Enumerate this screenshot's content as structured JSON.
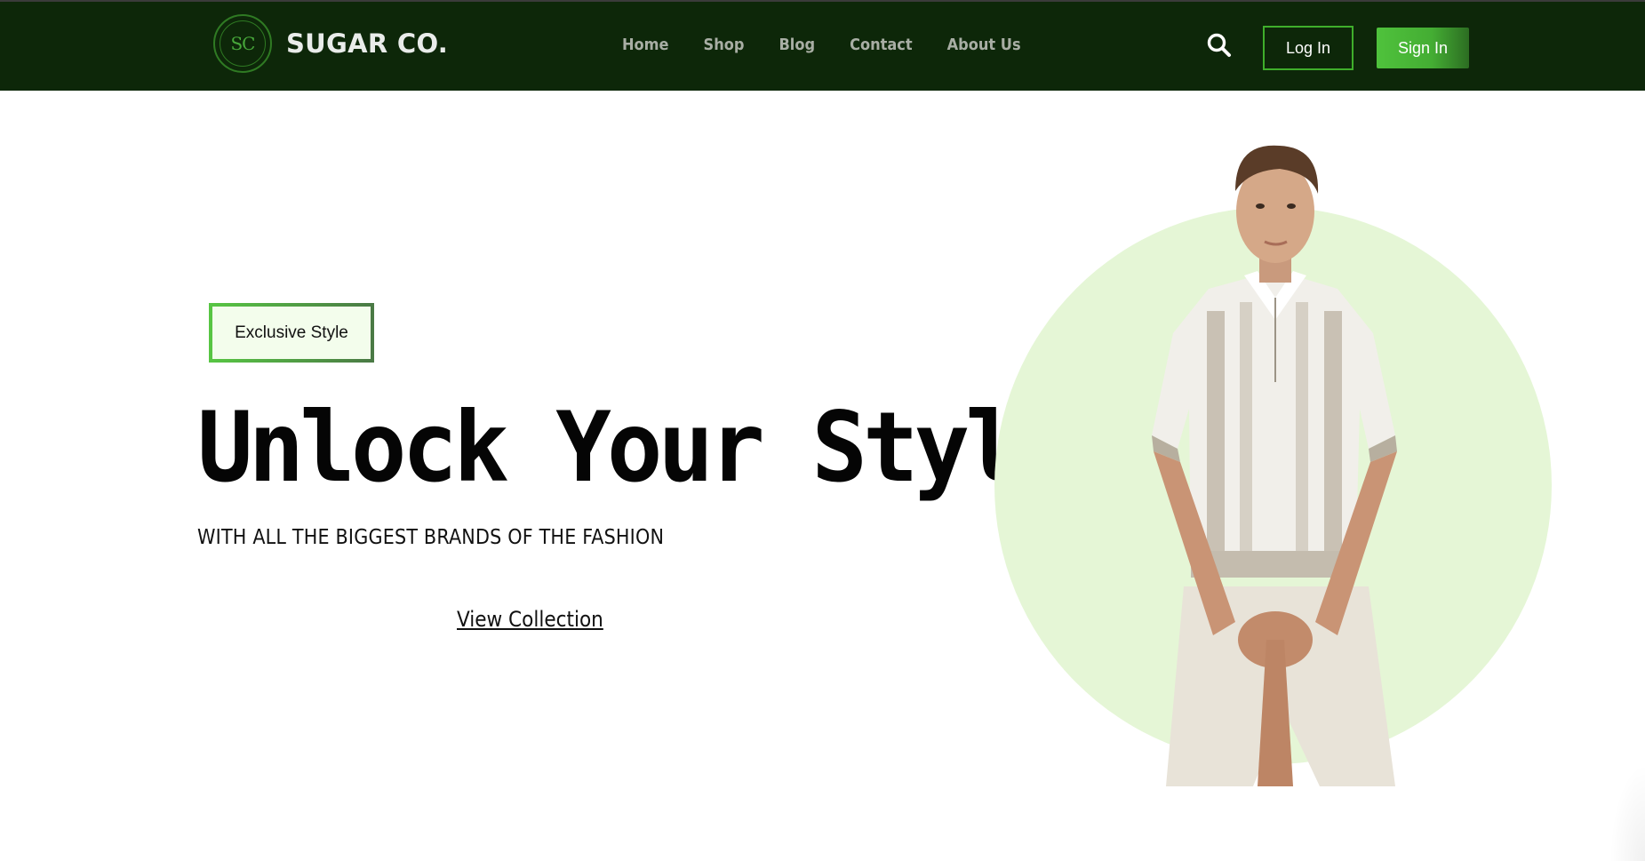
{
  "brand": {
    "logo_monogram": "SC",
    "name": "SUGAR CO."
  },
  "nav": {
    "links": [
      "Home",
      "Shop",
      "Blog",
      "Contact",
      "About Us"
    ]
  },
  "header_actions": {
    "search_icon": "search-icon",
    "login_label": "Log In",
    "signin_label": "Sign In"
  },
  "hero": {
    "badge": "Exclusive Style",
    "title": "Unlock Your Style",
    "subtitle": "WITH ALL THE BIGGEST BRANDS OF THE FASHION",
    "cta": "View Collection"
  },
  "colors": {
    "nav_bg": "#0d2709",
    "accent": "#4fc23c",
    "circle_bg": "#e5f6d6",
    "badge_bg": "#f3fdec"
  }
}
